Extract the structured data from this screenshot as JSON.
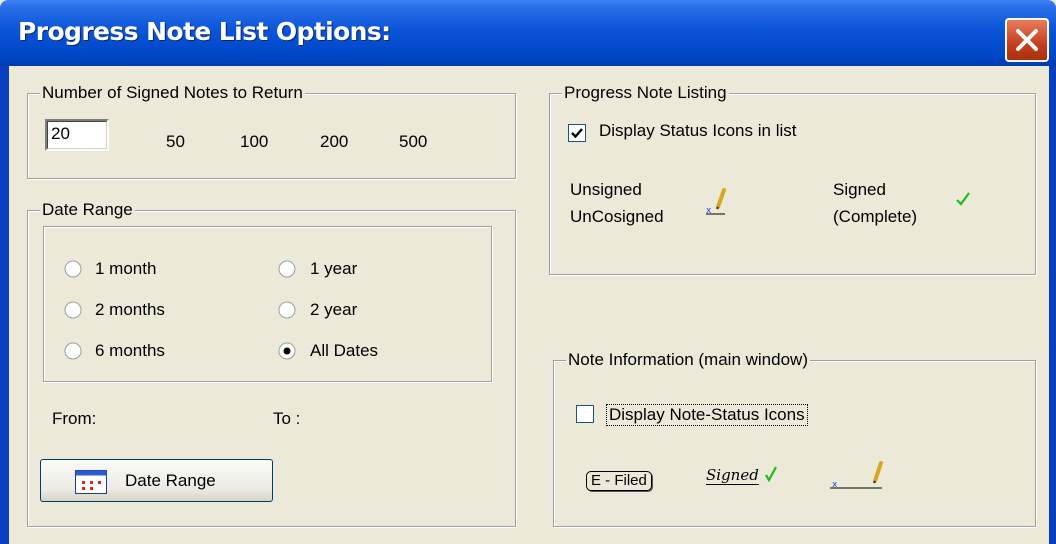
{
  "window": {
    "title": "Progress Note List Options:"
  },
  "signed_notes": {
    "legend": "Number of Signed Notes to Return",
    "value": "20",
    "options": [
      "50",
      "100",
      "200",
      "500"
    ]
  },
  "date_range": {
    "legend": "Date Range",
    "options": [
      {
        "label": "1 month",
        "selected": false
      },
      {
        "label": "2 months",
        "selected": false
      },
      {
        "label": "6 months",
        "selected": false
      },
      {
        "label": "1 year",
        "selected": false
      },
      {
        "label": "2 year",
        "selected": false
      },
      {
        "label": "All Dates",
        "selected": true
      }
    ],
    "from_label": "From:",
    "to_label": "To :",
    "button_label": "Date Range"
  },
  "listing": {
    "legend": "Progress Note Listing",
    "checkbox_label": "Display Status Icons in list",
    "checked": true,
    "unsigned_line1": "Unsigned",
    "unsigned_line2": "UnCosigned",
    "signed_line1": "Signed",
    "signed_line2": "(Complete)"
  },
  "note_info": {
    "legend": "Note Information (main window)",
    "checkbox_label": "Display Note-Status Icons",
    "checked": false,
    "efiled_label": "E - Filed",
    "signed_label": "Signed"
  },
  "colors": {
    "titlebar": "#0a55d8",
    "face": "#ece9d8",
    "check_green": "#22b822",
    "close": "#c5401f"
  }
}
